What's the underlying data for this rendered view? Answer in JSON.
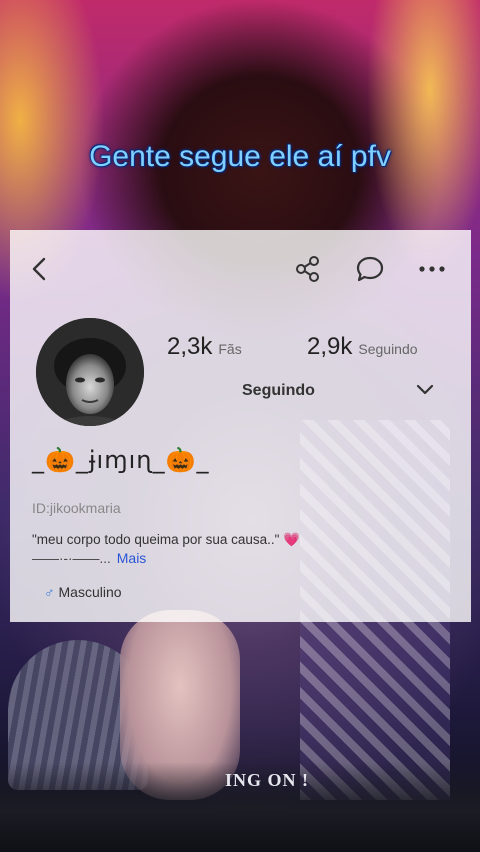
{
  "headline": "Gente segue ele aí pfv",
  "background": {
    "caption": "ING ON !"
  },
  "profile": {
    "fans_count": "2,3k",
    "fans_label": "Fãs",
    "following_count": "2,9k",
    "following_label": "Seguindo",
    "follow_state": "Seguindo",
    "username": "_🎃_ɉıɱıɳ_🎃_",
    "user_id": "ID:jikookmaria",
    "bio_line1": "\"meu corpo todo queima por sua causa..\" 💗",
    "bio_line2": "——·-·——...",
    "more_label": "Mais",
    "gender_label": "Masculino"
  },
  "icons": {
    "back": "chevron-left-icon",
    "share": "share-icon",
    "comment": "comment-icon",
    "more": "more-horizontal-icon",
    "dropdown": "chevron-down-icon",
    "gender": "male-icon"
  },
  "colors": {
    "headline": "#7fd0ff",
    "link": "#2a56d6",
    "gender_icon": "#3a7bd5"
  }
}
